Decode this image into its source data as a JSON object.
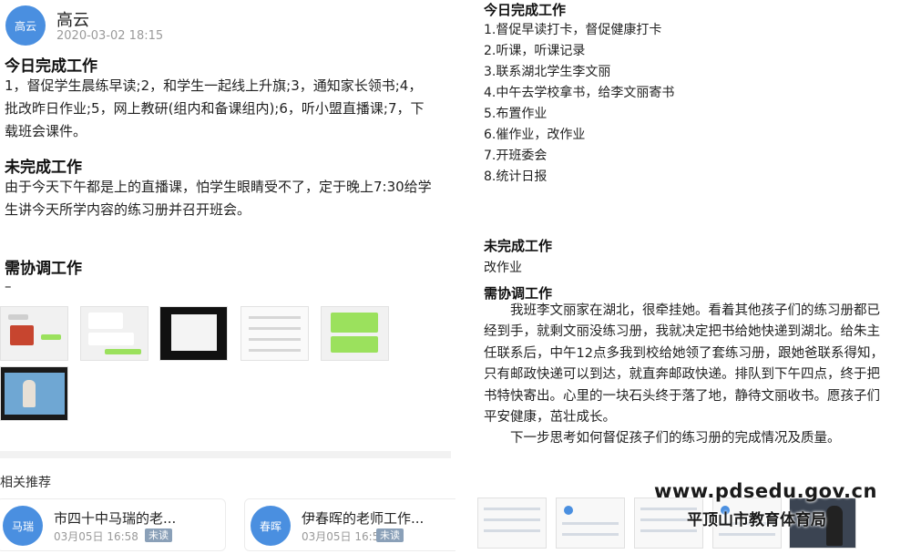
{
  "left_post": {
    "avatar_text": "高云",
    "author": "高云",
    "time": "2020-03-02 18:15",
    "done_heading": "今日完成工作",
    "done_text": "1，督促学生晨练早读;2，和学生一起线上升旗;3，通知家长领书;4，批改昨日作业;5，网上教研(组内和备课组内);6，听小盟直播课;7，下载班会课件。",
    "undone_heading": "未完成工作",
    "undone_text": "由于今天下午都是上的直播课，怕学生眼睛受不了，定于晚上7:30给学生讲今天所学内容的练习册并召开班会。",
    "coord_heading": "需协调工作",
    "coord_text": "–"
  },
  "recommend": {
    "title": "相关推荐",
    "cards": [
      {
        "avatar_text": "马瑞",
        "title": "市四十中马瑞的老...",
        "time": "03月05日 16:58",
        "badge": "未读"
      },
      {
        "avatar_text": "春晖",
        "title": "伊春晖的老师工作...",
        "time": "03月05日 16:58",
        "badge": "未读"
      }
    ]
  },
  "right_post": {
    "done_heading": "今日完成工作",
    "done_items": [
      "1.督促早读打卡，督促健康打卡",
      "2.听课，听课记录",
      "3.联系湖北学生李文丽",
      "4.中午去学校拿书，给李文丽寄书",
      "5.布置作业",
      "6.催作业，改作业",
      "7.开班委会",
      "8.统计日报"
    ],
    "undone_heading": "未完成工作",
    "undone_text": "改作业",
    "coord_heading": "需协调工作",
    "coord_para1": "我班李文丽家在湖北，很牵挂她。看着其他孩子们的练习册都已经到手，就剩文丽没练习册，我就决定把书给她快递到湖北。给朱主任联系后，中午12点多我到校给她领了套练习册，跟她爸联系得知，只有邮政快递可以到达，就直奔邮政快递。排队到下午四点，终于把书特快寄出。心里的一块石头终于落了地，静待文丽收书。愿孩子们平安健康，茁壮成长。",
    "coord_para2": "下一步思考如何督促孩子们的练习册的完成情况及质量。"
  },
  "watermark": {
    "url": "www.pdsedu.gov.cn",
    "name": "平顶山市教育体育局"
  },
  "colors": {
    "avatar_blue": "#4a8fe0",
    "badge_gray": "#8aa0b8",
    "chat_green": "#9be15d"
  }
}
